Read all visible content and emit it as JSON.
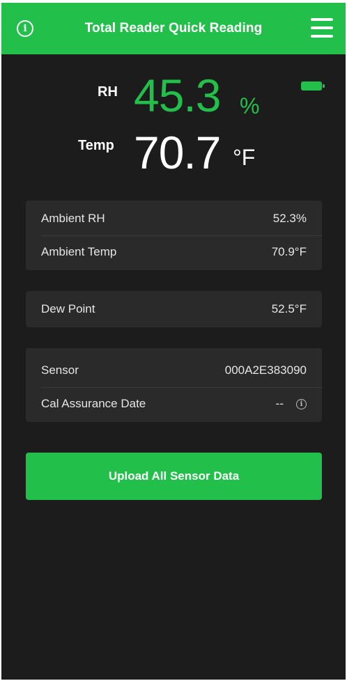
{
  "header": {
    "title": "Total Reader Quick Reading",
    "info_icon": "info-icon",
    "menu_icon": "hamburger-menu-icon"
  },
  "status": {
    "battery_icon": "battery-icon"
  },
  "reading": {
    "rh_label": "RH",
    "rh_value": "45.3",
    "rh_unit": "%",
    "temp_label": "Temp",
    "temp_value": "70.7",
    "temp_unit": "°F"
  },
  "ambient": {
    "rows": [
      {
        "label": "Ambient RH",
        "value": "52.3%"
      },
      {
        "label": "Ambient Temp",
        "value": "70.9°F"
      }
    ]
  },
  "dew_point": {
    "label": "Dew Point",
    "value": "52.5°F"
  },
  "sensor_info": {
    "sensor_label": "Sensor",
    "sensor_value": "000A2E383090",
    "cal_label": "Cal Assurance Date",
    "cal_value": "--",
    "cal_info_icon": "info-icon"
  },
  "actions": {
    "upload_label": "Upload All Sensor Data"
  },
  "colors": {
    "accent": "#22c04b",
    "background": "#1c1c1c",
    "card": "#2a2a2a",
    "text": "#ffffff"
  }
}
